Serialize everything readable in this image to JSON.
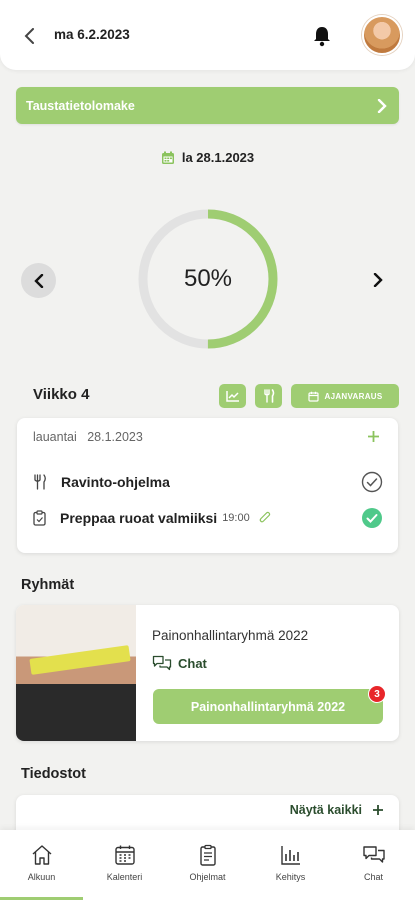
{
  "header": {
    "date": "ma 6.2.2023"
  },
  "banner": {
    "label": "Taustatietolomake"
  },
  "day_view": {
    "date": "la 28.1.2023",
    "progress_text": "50%",
    "progress_fraction": 0.5
  },
  "week": {
    "title": "Viikko 4",
    "booking_label": "AJANVARAUS"
  },
  "day_card": {
    "weekday": "lauantai",
    "date": "28.1.2023",
    "items": [
      {
        "label": "Ravinto-ohjelma",
        "time": "",
        "icon": "fork-knife-icon",
        "status": "not-done"
      },
      {
        "label": "Preppaa ruoat valmiiksi",
        "time": "19:00",
        "icon": "clipboard-icon",
        "status": "done"
      }
    ]
  },
  "groups": {
    "title": "Ryhmät",
    "name": "Painonhallintaryhmä 2022",
    "chat_label": "Chat",
    "button_label": "Painonhallintaryhmä 2022",
    "badge_count": "3"
  },
  "files": {
    "title": "Tiedostot",
    "show_all": "Näytä kaikki"
  },
  "bottom_nav": [
    {
      "label": "Alkuun",
      "icon": "home-icon",
      "active": true
    },
    {
      "label": "Kalenteri",
      "icon": "calendar-icon",
      "active": false
    },
    {
      "label": "Ohjelmat",
      "icon": "clipboard-icon",
      "active": false
    },
    {
      "label": "Kehitys",
      "icon": "bar-chart-icon",
      "active": false
    },
    {
      "label": "Chat",
      "icon": "chat-icon",
      "active": false
    }
  ],
  "colors": {
    "accent": "#9fcd72",
    "success": "#4fc98a",
    "badge": "#e8262a"
  }
}
